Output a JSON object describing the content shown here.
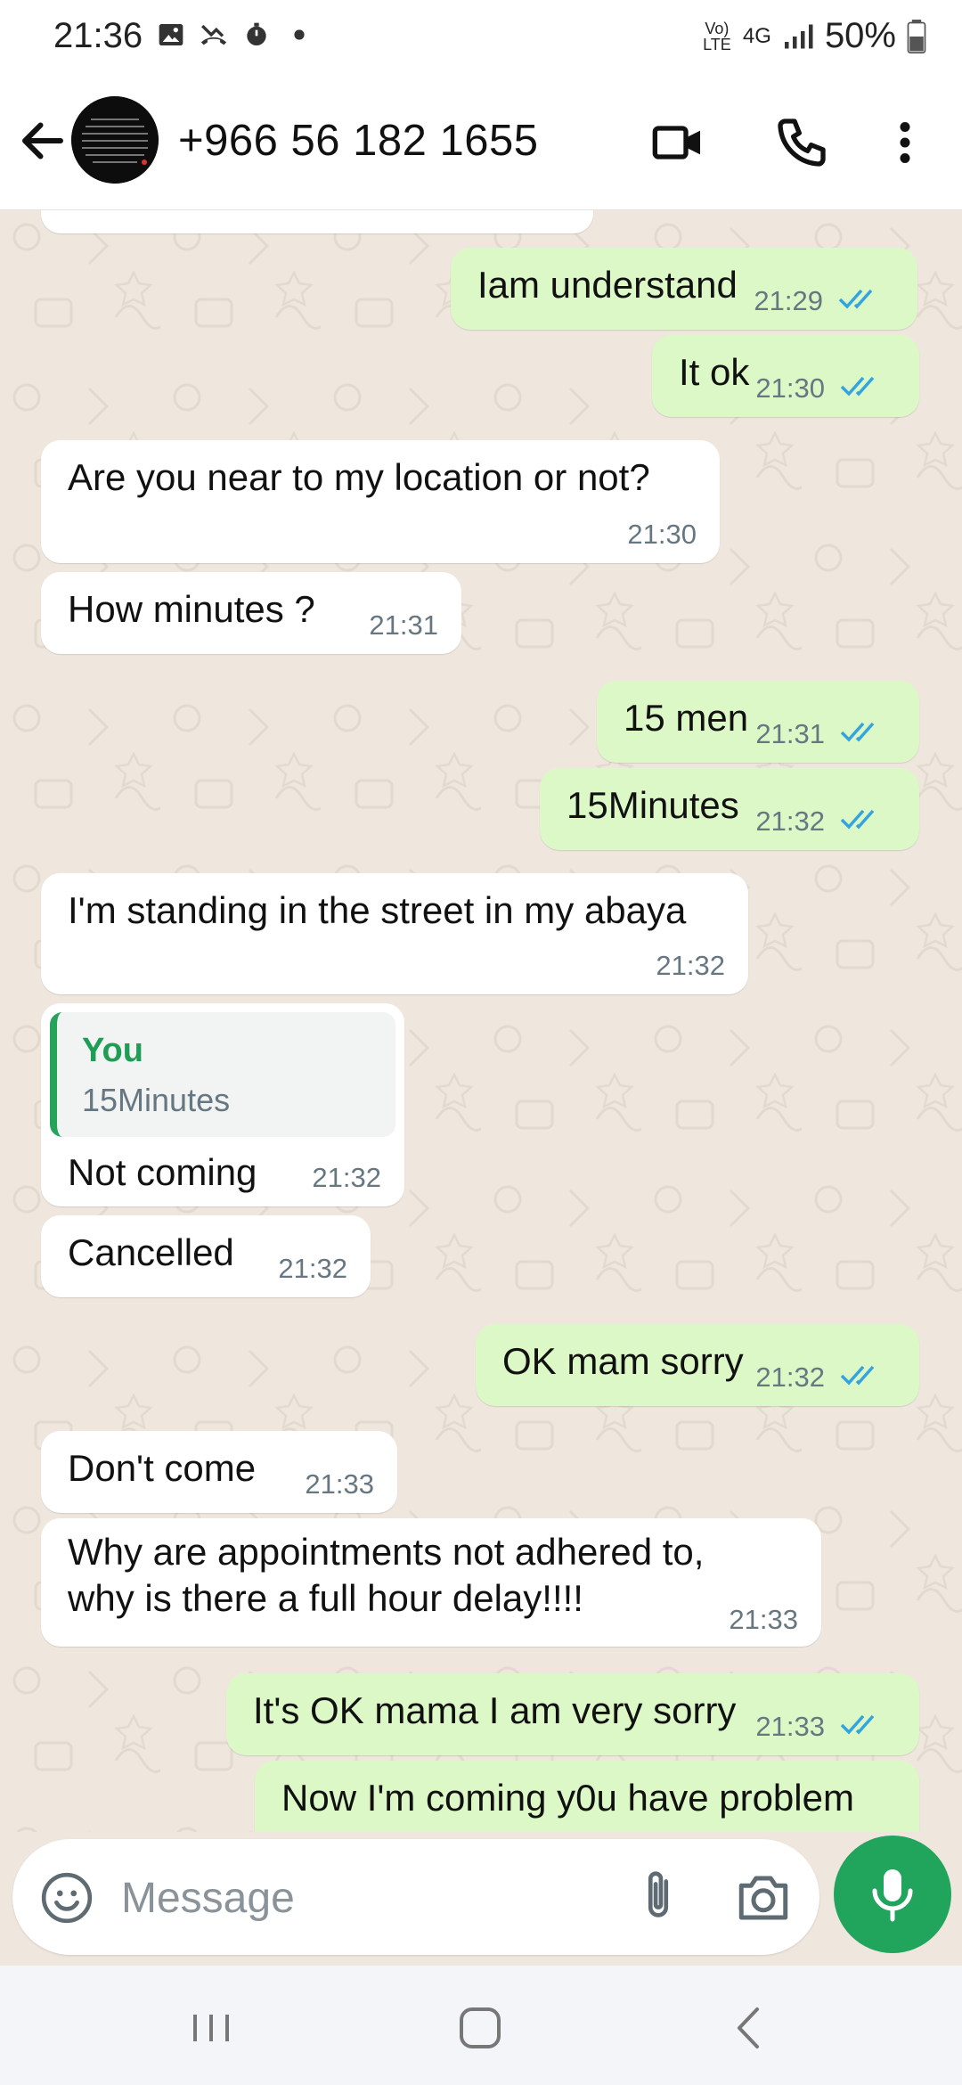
{
  "status_bar": {
    "time": "21:36",
    "left_icons": [
      "image-icon",
      "missed-call-icon",
      "timer-icon",
      "dot-icon"
    ],
    "network_label": "4G",
    "volte_label": "Vo) LTE",
    "battery_percent": "50%"
  },
  "header": {
    "contact": "+966 56 182 1655",
    "icons": [
      "back-arrow-icon",
      "video-call-icon",
      "phone-icon",
      "more-vert-icon"
    ]
  },
  "messages": [
    {
      "id": "m1",
      "dir": "out",
      "text": "Iam understand",
      "time": "21:29",
      "read": true
    },
    {
      "id": "m2",
      "dir": "out",
      "text": "It ok",
      "time": "21:30",
      "read": true
    },
    {
      "id": "m3",
      "dir": "in",
      "text": "Are you near  to my location or not?",
      "time": "21:30"
    },
    {
      "id": "m4",
      "dir": "in",
      "text": "How minutes ?",
      "time": "21:31"
    },
    {
      "id": "m5",
      "dir": "out",
      "text": "15 men",
      "time": "21:31",
      "read": true
    },
    {
      "id": "m6",
      "dir": "out",
      "text": "15Minutes",
      "time": "21:32",
      "read": true
    },
    {
      "id": "m7",
      "dir": "in",
      "text": "I'm standing in the street in my abaya",
      "time": "21:32"
    },
    {
      "id": "m8",
      "dir": "in",
      "quote_author": "You",
      "quote_text": "15Minutes",
      "text": "Not coming",
      "time": "21:32"
    },
    {
      "id": "m9",
      "dir": "in",
      "text": "Cancelled",
      "time": "21:32"
    },
    {
      "id": "m10",
      "dir": "out",
      "text": "OK mam sorry",
      "time": "21:32",
      "read": true
    },
    {
      "id": "m11",
      "dir": "in",
      "text": "Don't come",
      "time": "21:33"
    },
    {
      "id": "m12",
      "dir": "in",
      "text_line1": "Why are appointments not adhered to,",
      "text_line2": "why is there a full hour delay!!!!",
      "time": "21:33"
    },
    {
      "id": "m13",
      "dir": "out",
      "text": "It's OK mama I am very sorry",
      "time": "21:33",
      "read": true
    },
    {
      "id": "m14",
      "dir": "out",
      "text": "Now I'm coming y0u have problem"
    }
  ],
  "composer": {
    "placeholder": "Message",
    "icons": [
      "emoji-icon",
      "attach-icon",
      "camera-icon",
      "mic-icon"
    ]
  },
  "navbar": {
    "icons": [
      "recents-icon",
      "home-icon",
      "back-nav-icon"
    ]
  },
  "colors": {
    "outgoing_bubble": "#dcf8c6",
    "incoming_bubble": "#ffffff",
    "chat_background": "#efe7de",
    "read_ticks": "#34a4e0",
    "quote_accent": "#25a35a",
    "mic_button": "#21a45c"
  }
}
